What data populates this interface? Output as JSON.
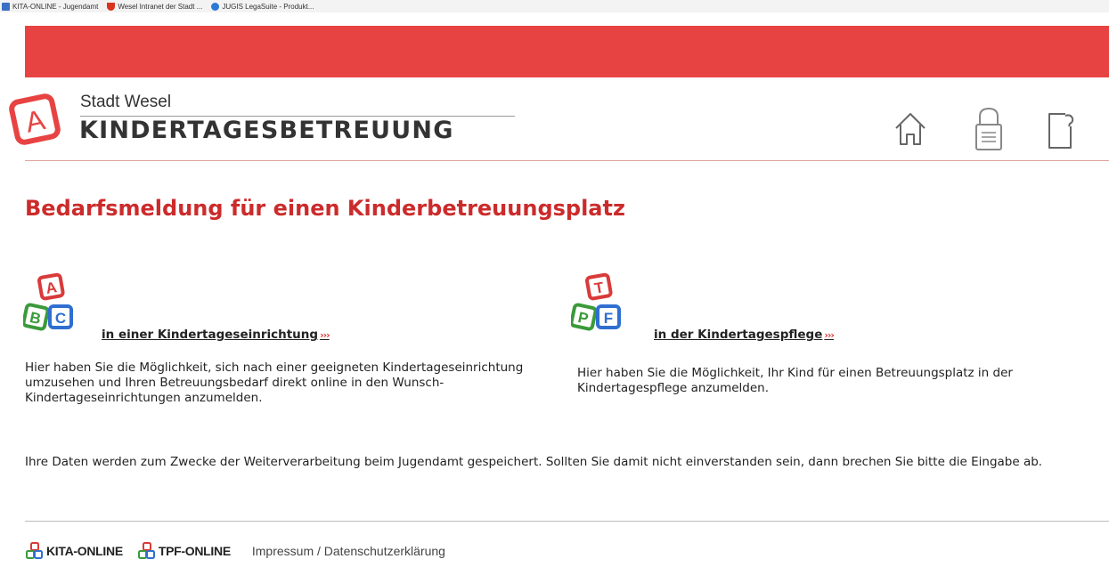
{
  "browser": {
    "favorites": [
      {
        "label": "KITA-ONLINE - Jugendamt",
        "icon": "page-icon"
      },
      {
        "label": "Wesel  Intranet der Stadt ...",
        "icon": "shield-icon"
      },
      {
        "label": "JUGIS LegaSuite - Produkt...",
        "icon": "ie-icon"
      }
    ]
  },
  "header": {
    "logo_letter": "A",
    "brand_sub": "Stadt Wesel",
    "brand_title": "KINDERTAGESBETREUUNG",
    "icons": [
      "home-icon",
      "lock-icon",
      "logout-icon"
    ]
  },
  "main": {
    "title": "Bedarfsmeldung für einen Kinderbetreuungsplatz",
    "options": [
      {
        "blocks": [
          "A",
          "B",
          "C"
        ],
        "link": "in einer Kindertageseinrichtung",
        "arrow": "›››",
        "description": "Hier haben Sie die Möglichkeit, sich nach einer geeigneten Kindertageseinrichtung umzusehen und Ihren Betreuungsbedarf direkt online in den Wunsch-Kindertageseinrichtungen anzumelden."
      },
      {
        "blocks": [
          "T",
          "P",
          "F"
        ],
        "link": "in der Kindertagespflege",
        "arrow": "›››",
        "description": "Hier haben Sie die Möglichkeit, Ihr Kind für einen Betreuungsplatz in der Kindertagespflege anzumelden."
      }
    ],
    "privacy_note": "Ihre Daten werden zum Zwecke der Weiterverarbeitung beim Jugendamt gespeichert. Sollten Sie damit nicht einverstanden sein, dann brechen Sie bitte die Eingabe ab."
  },
  "footer": {
    "kita_label": "KITA-ONLINE",
    "tpf_label": "TPF-ONLINE",
    "impressum": "Impressum / Datenschutzerklärung"
  },
  "colors": {
    "brand_red": "#e84343",
    "title_red": "#cc2b2b",
    "block_red": "#d93a3a",
    "block_green": "#3a9a3a",
    "block_blue": "#2f6fd0"
  }
}
